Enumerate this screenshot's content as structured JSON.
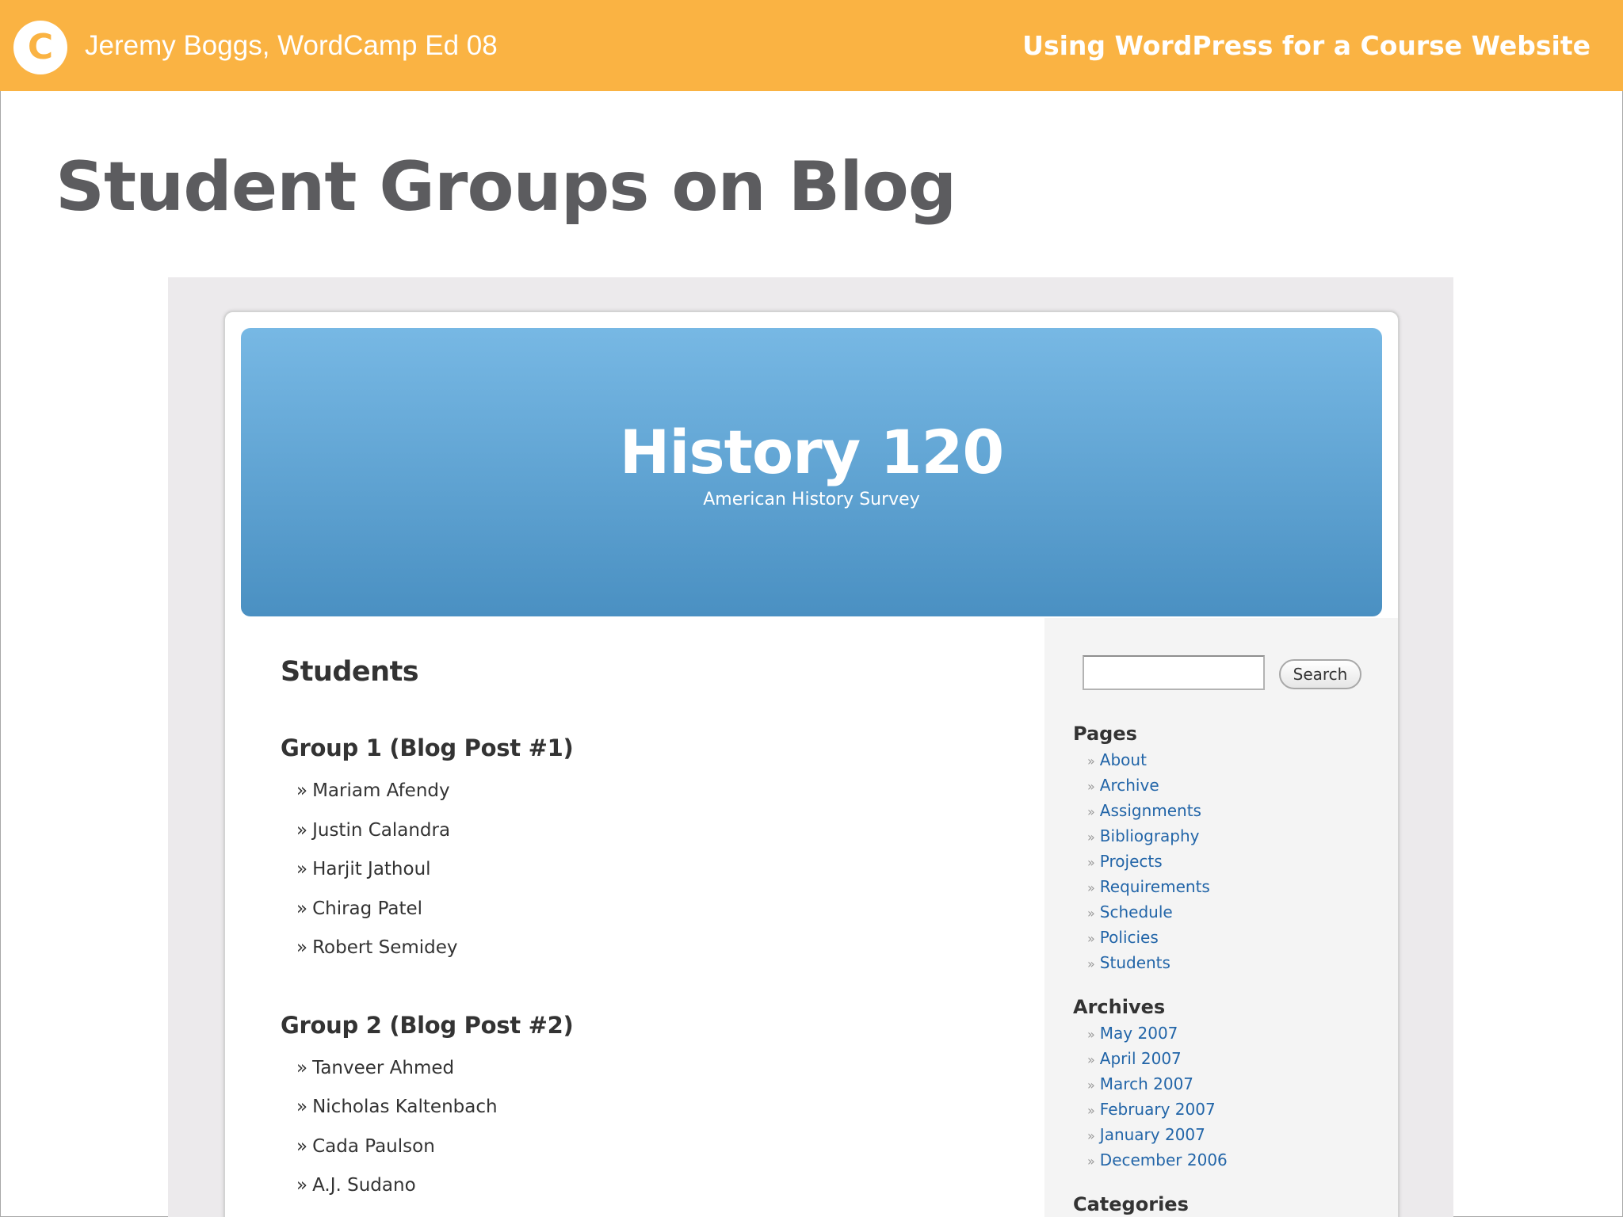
{
  "banner": {
    "logo_letter": "C",
    "presenter": "Jeremy Boggs, WordCamp Ed 08",
    "talk_title": "Using WordPress for a Course Website"
  },
  "slide": {
    "title": "Student Groups on Blog"
  },
  "blog": {
    "title": "History 120",
    "description": "American History Survey",
    "page_heading": "Students",
    "groups": [
      {
        "title": "Group 1 (Blog Post #1)",
        "members": [
          "Mariam Afendy",
          "Justin Calandra",
          "Harjit Jathoul",
          "Chirag Patel",
          "Robert Semidey"
        ]
      },
      {
        "title": "Group 2 (Blog Post #2)",
        "members": [
          "Tanveer Ahmed",
          "Nicholas Kaltenbach",
          "Cada Paulson",
          "A.J. Sudano"
        ]
      }
    ],
    "search": {
      "value": "",
      "button_label": "Search"
    },
    "sidebar": {
      "pages": {
        "title": "Pages",
        "items": [
          "About",
          "Archive",
          "Assignments",
          "Bibliography",
          "Projects",
          "Requirements",
          "Schedule",
          "Policies",
          "Students"
        ]
      },
      "archives": {
        "title": "Archives",
        "items": [
          "May 2007",
          "April 2007",
          "March 2007",
          "February 2007",
          "January 2007",
          "December 2006"
        ]
      },
      "categories": {
        "title": "Categories"
      }
    },
    "bullet": "»",
    "colors": {
      "banner": "#fab343",
      "header_top": "#77b8e4",
      "header_bottom": "#4a90c2",
      "link": "#2265a8",
      "title_text": "#5c5c5f"
    }
  }
}
